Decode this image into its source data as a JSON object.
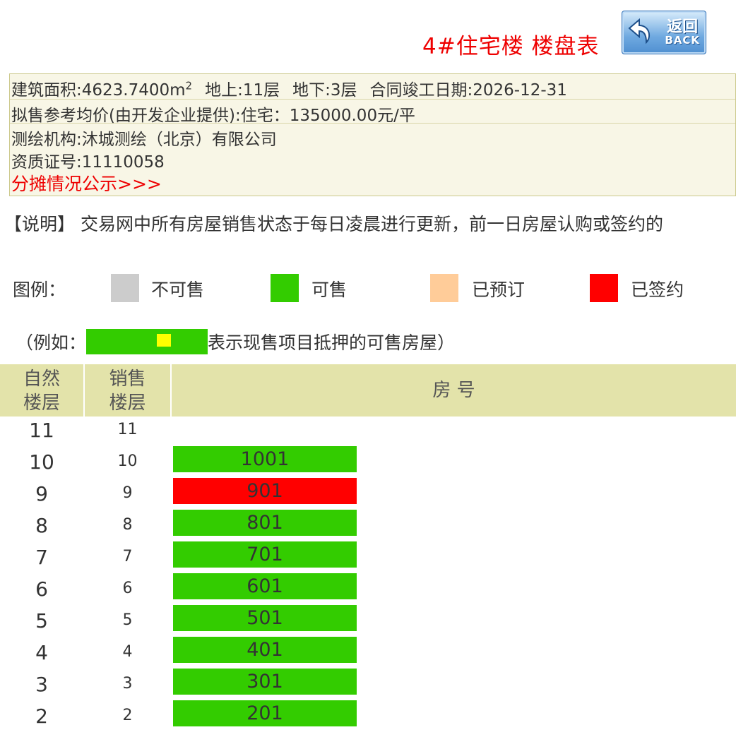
{
  "header": {
    "title": "4#住宅楼 楼盘表",
    "back_cn": "返回",
    "back_en": "BACK"
  },
  "info": {
    "area_label": "建筑面积:4623.7400m",
    "area_sup": "2",
    "above": "地上:11层",
    "below": "地下:3层",
    "completion": "合同竣工日期:2026-12-31",
    "price": "拟售参考均价(由开发企业提供):住宅：135000.00元/平",
    "agency": "测绘机构:沐城测绘（北京）有限公司",
    "cert": "资质证号:11110058",
    "share_link": "分摊情况公示>>>"
  },
  "note": "【说明】 交易网中所有房屋销售状态于每日凌晨进行更新，前一日房屋认购或签约的",
  "legend": {
    "label": "图例：",
    "items": [
      {
        "text": "不可售",
        "color": "#cccccc"
      },
      {
        "text": "可售",
        "color": "#33cc00"
      },
      {
        "text": "已预订",
        "color": "#ffcc99"
      },
      {
        "text": "已签约",
        "color": "#ff0000"
      }
    ]
  },
  "example": {
    "prefix": "（例如：",
    "suffix": "表示现售项目抵押的可售房屋）",
    "bar_color": "#33cc00",
    "dot_color": "#ffff00"
  },
  "table": {
    "col1": [
      "自然",
      "楼层"
    ],
    "col2": [
      "销售",
      "楼层"
    ],
    "col3": "房 号",
    "rows": [
      {
        "nat": "11",
        "sale": "11",
        "unit": "",
        "status": "none"
      },
      {
        "nat": "10",
        "sale": "10",
        "unit": "1001",
        "status": "available"
      },
      {
        "nat": "9",
        "sale": "9",
        "unit": "901",
        "status": "signed"
      },
      {
        "nat": "8",
        "sale": "8",
        "unit": "801",
        "status": "available"
      },
      {
        "nat": "7",
        "sale": "7",
        "unit": "701",
        "status": "available"
      },
      {
        "nat": "6",
        "sale": "6",
        "unit": "601",
        "status": "available"
      },
      {
        "nat": "5",
        "sale": "5",
        "unit": "501",
        "status": "available"
      },
      {
        "nat": "4",
        "sale": "4",
        "unit": "401",
        "status": "available"
      },
      {
        "nat": "3",
        "sale": "3",
        "unit": "301",
        "status": "available"
      },
      {
        "nat": "2",
        "sale": "2",
        "unit": "201",
        "status": "available"
      }
    ]
  },
  "status_colors": {
    "available": "#33cc00",
    "signed": "#ff0000",
    "reserved": "#ffcc99",
    "unavailable": "#cccccc"
  }
}
